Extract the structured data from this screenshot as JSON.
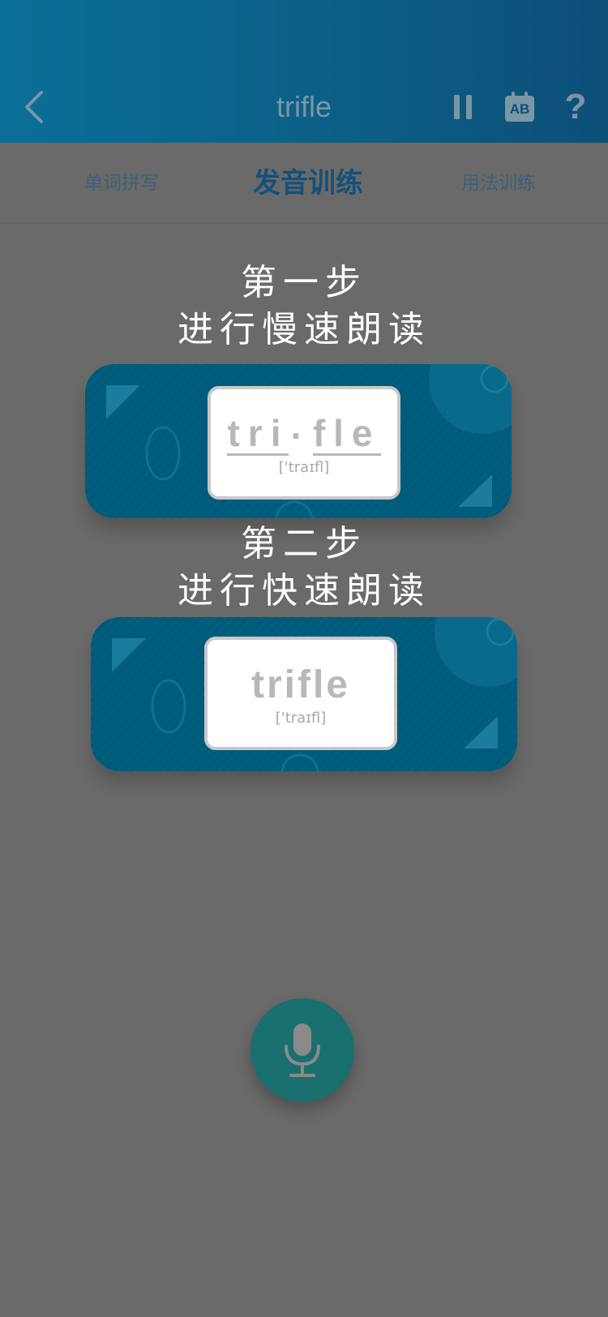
{
  "header": {
    "title": "trifle",
    "back_icon": "chevron-left-icon",
    "pause_icon": "pause-icon",
    "calendar_icon": "calendar-ab-icon",
    "calendar_label": "AB",
    "help_label": "?"
  },
  "tabs": [
    {
      "label": "单词拼写",
      "active": false
    },
    {
      "label": "发音训练",
      "active": true
    },
    {
      "label": "用法训练",
      "active": false
    }
  ],
  "steps": [
    {
      "title_line1": "第一步",
      "title_line2": "进行慢速朗读",
      "syllables": [
        "tri",
        "·",
        "fle"
      ],
      "phonetic": "['traɪfl]"
    },
    {
      "title_line1": "第二步",
      "title_line2": "进行快速朗读",
      "word": "trifle",
      "phonetic": "['traɪfl]"
    }
  ],
  "mic": {
    "icon": "microphone-icon"
  },
  "colors": {
    "header": "#0c5d84",
    "active_tab": "#14507a",
    "card": "#005e7e",
    "mic": "#19706e",
    "overlay": "#6a6a6a"
  }
}
